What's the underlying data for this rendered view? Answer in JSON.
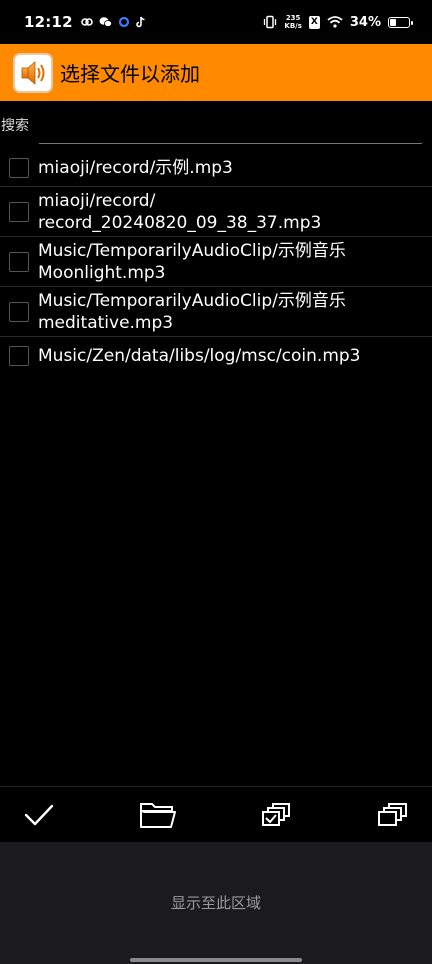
{
  "status_bar": {
    "time": "12:12",
    "left_icons": [
      "link-icon",
      "wechat-icon",
      "circle-app-icon",
      "tiktok-icon"
    ],
    "net_speed_value": "235",
    "net_speed_unit": "KB/s",
    "sim_label": "X",
    "battery_percent": "34%",
    "battery_level": 0.34
  },
  "title_bar": {
    "title": "选择文件以添加",
    "icon": "speaker-icon",
    "accent_color": "#ff8a00"
  },
  "search": {
    "label": "搜索",
    "value": "",
    "placeholder": ""
  },
  "files": [
    {
      "name": "miaoji/record/示例.mp3",
      "checked": false
    },
    {
      "name": "miaoji/record/\nrecord_20240820_09_38_37.mp3",
      "checked": false
    },
    {
      "name": "Music/TemporarilyAudioClip/示例音乐\nMoonlight.mp3",
      "checked": false
    },
    {
      "name": "Music/TemporarilyAudioClip/示例音乐\nmeditative.mp3",
      "checked": false
    },
    {
      "name": "Music/Zen/data/libs/log/msc/coin.mp3",
      "checked": false
    }
  ],
  "toolbar": {
    "confirm_icon": "checkmark-icon",
    "folder_icon": "folder-icon",
    "select_icon": "select-all-icon",
    "copy_icon": "copy-icon"
  },
  "ad_area": {
    "text": "显示至此区域"
  }
}
